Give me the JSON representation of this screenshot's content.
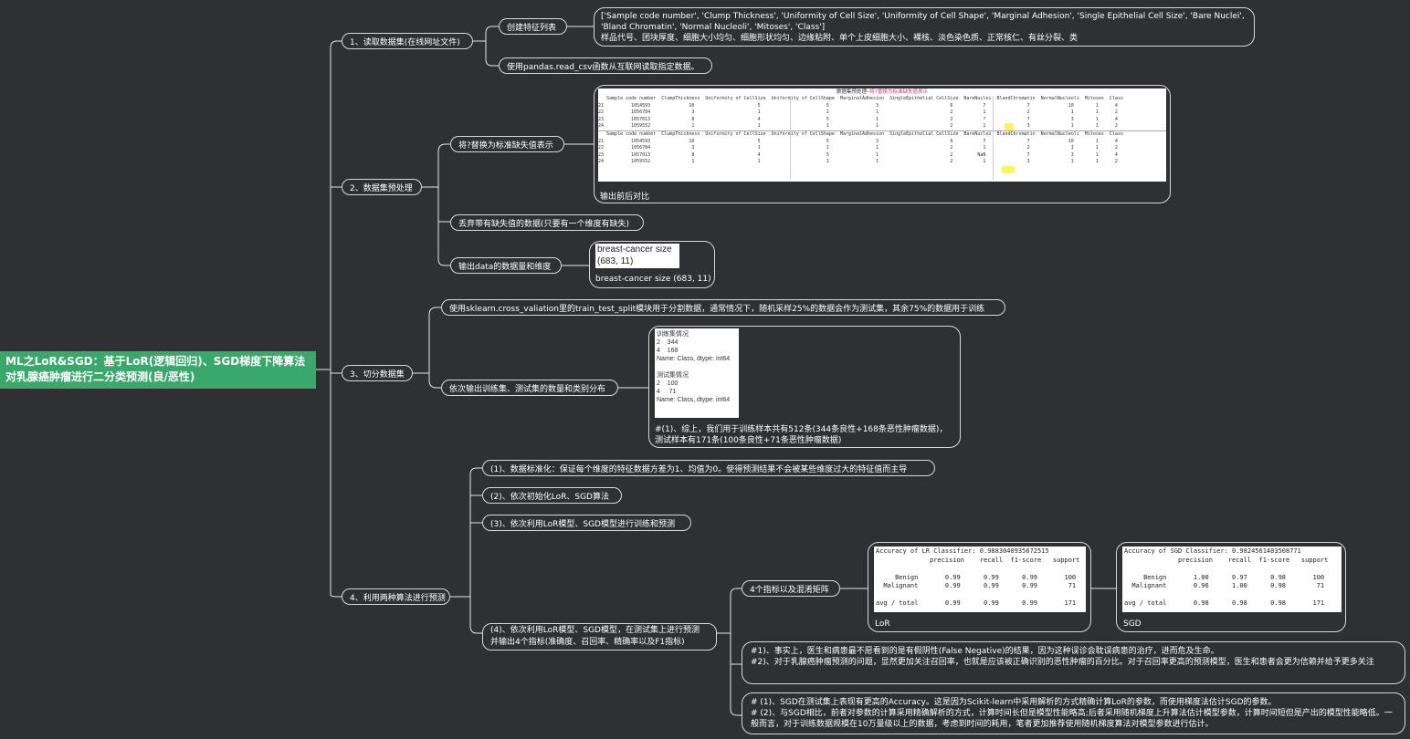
{
  "root": {
    "title": "ML之LoR&SGD：基于LoR(逻辑回归)、SGD梯度下降算法对乳腺癌肿瘤进行二分类预测(良/恶性)"
  },
  "sections": {
    "s1": {
      "label": "1、读取数据集(在线网址文件)",
      "c1": "创建特征列表",
      "c1_detail_en": "['Sample code number', 'Clump Thickness', 'Uniformity of Cell Size', 'Uniformity of Cell Shape', 'Marginal Adhesion', 'Single Epithelial Cell Size', 'Bare Nuclei', 'Bland Chromatin', 'Normal Nucleoli', 'Mitoses', 'Class']",
      "c1_detail_zh": "样品代号、团块厚度、细胞大小均匀、细胞形状均匀、边缘粘附、单个上皮细胞大小、裸核、淡色染色质、正常核仁、有丝分裂、类",
      "c2": "使用pandas.read_csv函数从互联网读取指定数据。"
    },
    "s2": {
      "label": "2、数据集预处理",
      "c1": "将?替换为标准缺失值表示",
      "c1_caption": "输出前后对比",
      "table_title_a": "数据集预处理—",
      "table_title_b": "将?替换为标准缺失值表示",
      "table_header": "   Sample code number  ClumpThickness  Uniformity of CellSize  Uniformity of CellShape  MarginalAdhesion  SingleEpithelial CellSize  BareNuclei  BlandChromatin  NormalNucleoli  Mitoses  Class",
      "table_rows_a": "21          1054593              10                       5                        5                 3                          6           7               7              10        1      4\n22          1056784               3                       1                        1                 1                          2           1               2               1        1      2\n23          1057013               8                       4                        5                 1                          2           ?               7               3        1      4\n24          1059552               1                       1                        1                 1                          2           1               3               1        1      2",
      "table_rows_b": "21          1054593              10                       5                        5                 3                          6           7               7              10        1      4\n22          1056784               3                       1                        1                 1                          2           1               2               1        1      2\n23          1057013               8                       4                        5                 1                          2         NaN               7               3        1      4\n24          1059552               1                       1                        1                 1                          2           1               3               1        1      2",
      "c2": "丢弃带有缺失值的数据(只要有一个维度有缺失)",
      "c3": "输出data的数据量和维度",
      "c3_out_line1": "breast-cancer size",
      "c3_out_line2": "(683, 11)",
      "c3_caption": "breast-cancer size (683, 11)"
    },
    "s3": {
      "label": "3、切分数据集",
      "c1": "使用sklearn.cross_valiation里的train_test_split模块用于分割数据，通常情况下，随机采样25%的数据会作为测试集，其余75%的数据用于训练",
      "c2": "依次输出训练集、测试集的数量和类别分布",
      "out": "训练集情况\n2    344\n4    168\nName: Class, dtype: int64\n\n测试集情况\n2    100\n4     71\nName: Class, dtype: int64",
      "note1": "#(1)、综上，我们用于训练样本共有512条(344条良性+168条恶性肿瘤数据)，",
      "note2": "测试样本有171条(100条良性+71条恶性肿瘤数据)"
    },
    "s4": {
      "label": "4、利用两种算法进行预测",
      "c1": "(1)、数据标准化：保证每个维度的特征数据方差为1、均值为0。使得预测结果不会被某些维度过大的特征值而主导",
      "c2": "(2)、依次初始化LoR、SGD算法",
      "c3": "(3)、依次利用LoR模型、SGD模型进行训练和预测",
      "c4_line1": "(4)、依次利用LoR模型、SGD模型，在测试集上进行预测",
      "c4_line2": "并输出4个指标(准确度、召回率、精确率以及F1指标)",
      "metrics_label": "4个指标以及混淆矩阵",
      "lor_caption": "LoR",
      "lor_report": "Accuracy of LR Classifier: 0.9883040935672515\n              precision    recall  f1-score   support\n\n     Benign       0.99      0.99      0.99       100\n  Malignant       0.99      0.99      0.99        71\n\navg / total       0.99      0.99      0.99       171",
      "sgd_caption": "SGD",
      "sgd_report": "Accuracy of SGD Classifier: 0.9824561403508771\n              precision    recall  f1-score   support\n\n     Benign       1.00      0.97      0.98       100\n  Malignant       0.96      1.00      0.98        71\n\navg / total       0.98      0.98      0.98       171",
      "note1_a": "#1)、事实上，医生和病患最不愿看到的是有假阴性(False Negative)的结果，因为这种误诊会耽误病患的治疗，进而危及生命。",
      "note1_b": "#2)、对于乳腺癌肿瘤预测的问题，显然更加关注召回率，也就是应该被正确识别的恶性肿瘤的百分比。对于召回率更高的预测模型，医生和患者会更为信赖并给予更多关注",
      "note2_a": "# (1)、SGD在测试集上表现有更高的Accuracy。这是因为Scikit-learn中采用解析的方式精确计算LoR的参数，而使用梯度法估计SGD的参数。",
      "note2_b": "# (2)、与SGD相比，前者对参数的计算采用精确解析的方式，计算时间长但是模型性能略高;后者采用随机梯度上升算法估计模型参数，计算时间短但是产出的模型性能略低。一般而言，对于训练数据规模在10万量级以上的数据，考虑到时间的耗用，笔者更加推荐使用随机梯度算法对模型参数进行估计。"
    }
  }
}
